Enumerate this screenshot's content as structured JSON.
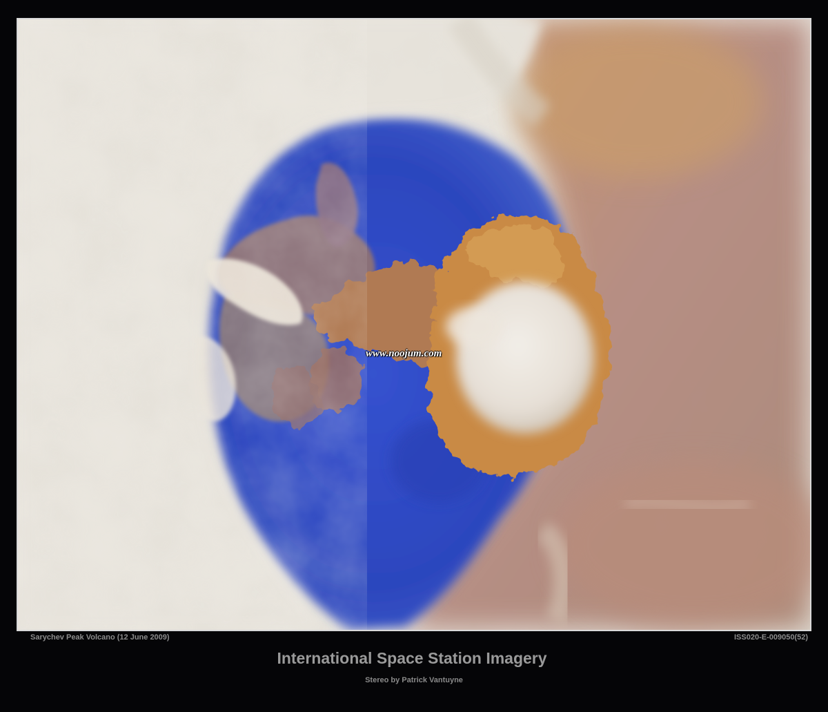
{
  "image": {
    "subject": "volcano-eruption-satellite-photo",
    "colors": {
      "ocean": "#2f4fc8",
      "cloud": "#e8e4dc",
      "ash": "#c98a45",
      "haze": "#b88a78",
      "frame_border": "#d9d9d9",
      "background": "#050507",
      "caption_text": "#8c8c8c"
    }
  },
  "watermark": "www.noojum.com",
  "captions": {
    "location_date": "Sarychev Peak Volcano (12 June 2009)",
    "image_id": "ISS020-E-009050(52)",
    "title": "International Space Station Imagery",
    "credit": "Stereo by Patrick Vantuyne"
  }
}
